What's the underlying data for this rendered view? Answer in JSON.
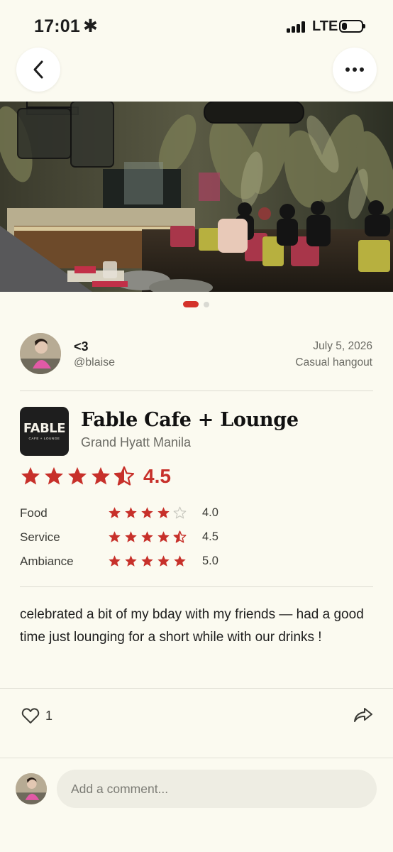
{
  "status_bar": {
    "time": "17:01",
    "time_icon": "asterisk-icon",
    "network": "LTE",
    "battery_level": 0.25
  },
  "nav": {
    "back_icon": "chevron-left-icon",
    "more_icon": "more-horizontal-icon"
  },
  "carousel": {
    "total_images": 2,
    "current_index": 0
  },
  "author": {
    "name": "<3",
    "handle": "@blaise",
    "date": "July 5, 2026",
    "tag": "Casual hangout"
  },
  "restaurant": {
    "name": "Fable Cafe + Lounge",
    "location": "Grand Hyatt Manila",
    "logo_text": "FABLE",
    "logo_subtext": "CAFE + LOUNGE",
    "overall_rating": 4.5,
    "overall_rating_text": "4.5"
  },
  "ratings": [
    {
      "label": "Food",
      "value": 4.0,
      "value_text": "4.0"
    },
    {
      "label": "Service",
      "value": 4.5,
      "value_text": "4.5"
    },
    {
      "label": "Ambiance",
      "value": 5.0,
      "value_text": "5.0"
    }
  ],
  "review": {
    "text": "celebrated a bit of my bday with my friends — had a good time just lounging for a short while with our drinks !"
  },
  "actions": {
    "like_count": "1",
    "like_icon": "heart-icon",
    "share_icon": "share-icon"
  },
  "comment": {
    "placeholder": "Add a comment..."
  },
  "colors": {
    "accent": "#d4322a",
    "star": "#c7302a",
    "background": "#fbfaf0",
    "input_bg": "#eeede3"
  }
}
